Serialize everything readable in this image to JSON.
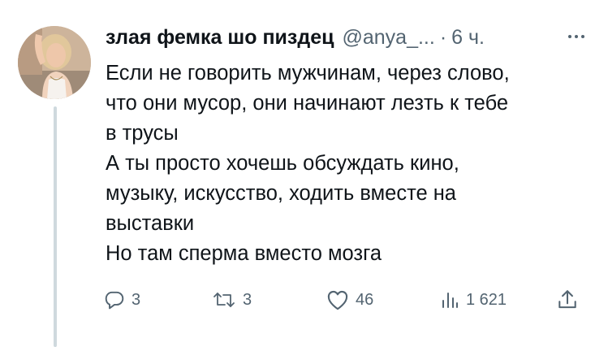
{
  "tweet": {
    "display_name": "злая фемка шо пиздец",
    "handle": "@anya_...",
    "separator": "·",
    "time": "6 ч.",
    "lines": [
      "Если не говорить мужчинам, через слово,",
      "что они мусор, они начинают лезть к тебе",
      "в трусы",
      "А ты просто хочешь обсуждать кино,",
      "музыку, искусство, ходить вместе на",
      "выставки",
      "Но там сперма вместо мозга"
    ],
    "replies": "3",
    "retweets": "3",
    "likes": "46",
    "views": "1 621"
  },
  "colors": {
    "text": "#0f1419",
    "secondary": "#536471",
    "thread_line": "#cfd9de"
  },
  "icons": {
    "reply": "reply-icon",
    "retweet": "retweet-icon",
    "like": "heart-icon",
    "views": "views-icon",
    "share": "share-icon",
    "more": "more-icon"
  }
}
